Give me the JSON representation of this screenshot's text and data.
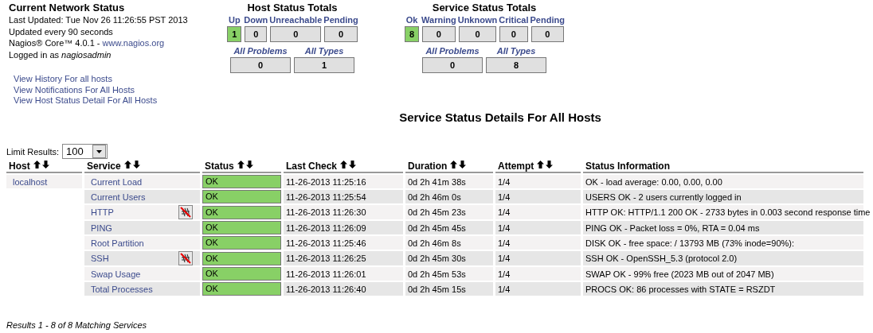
{
  "network_status": {
    "title": "Current Network Status",
    "last_updated": "Last Updated: Tue Nov 26 11:26:55 PST 2013",
    "interval": "Updated every 90 seconds",
    "version_prefix": "Nagios® Core™ 4.0.1 - ",
    "version_link": "www.nagios.org",
    "logged_in_prefix": "Logged in as ",
    "user": "nagiosadmin"
  },
  "links": [
    "View History For all hosts",
    "View Notifications For All Hosts",
    "View Host Status Detail For All Hosts"
  ],
  "host_totals": {
    "title": "Host Status Totals",
    "counts": [
      {
        "label": "Up",
        "value": "1",
        "highlighted": true
      },
      {
        "label": "Down",
        "value": "0",
        "highlighted": false
      },
      {
        "label": "Unreachable",
        "value": "0",
        "highlighted": false
      },
      {
        "label": "Pending",
        "value": "0",
        "highlighted": false
      }
    ],
    "summary": [
      {
        "label": "All Problems",
        "value": "0"
      },
      {
        "label": "All Types",
        "value": "1"
      }
    ]
  },
  "service_totals": {
    "title": "Service Status Totals",
    "counts": [
      {
        "label": "Ok",
        "value": "8",
        "highlighted": true
      },
      {
        "label": "Warning",
        "value": "0",
        "highlighted": false
      },
      {
        "label": "Unknown",
        "value": "0",
        "highlighted": false
      },
      {
        "label": "Critical",
        "value": "0",
        "highlighted": false
      },
      {
        "label": "Pending",
        "value": "0",
        "highlighted": false
      }
    ],
    "summary": [
      {
        "label": "All Problems",
        "value": "0"
      },
      {
        "label": "All Types",
        "value": "8"
      }
    ]
  },
  "page_title": "Service Status Details For All Hosts",
  "limit": {
    "label": "Limit Results:",
    "value": "100"
  },
  "table": {
    "columns": [
      {
        "label": "Host",
        "sortable": true
      },
      {
        "label": "Service",
        "sortable": true
      },
      {
        "label": "Status",
        "sortable": true
      },
      {
        "label": "Last Check",
        "sortable": true
      },
      {
        "label": "Duration",
        "sortable": true
      },
      {
        "label": "Attempt",
        "sortable": true
      },
      {
        "label": "Status Information",
        "sortable": false
      }
    ],
    "rows": [
      {
        "host": "localhost",
        "service": "Current Load",
        "notifications_disabled": false,
        "status": "OK",
        "last_check": "11-26-2013 11:25:16",
        "duration": "0d 2h 41m 38s",
        "attempt": "1/4",
        "info": "OK - load average: 0.00, 0.00, 0.00"
      },
      {
        "service": "Current Users",
        "notifications_disabled": false,
        "status": "OK",
        "last_check": "11-26-2013 11:25:54",
        "duration": "0d 2h 46m 0s",
        "attempt": "1/4",
        "info": "USERS OK - 2 users currently logged in"
      },
      {
        "service": "HTTP",
        "notifications_disabled": true,
        "status": "OK",
        "last_check": "11-26-2013 11:26:30",
        "duration": "0d 2h 45m 23s",
        "attempt": "1/4",
        "info": "HTTP OK: HTTP/1.1 200 OK - 2733 bytes in 0.003 second response time"
      },
      {
        "service": "PING",
        "notifications_disabled": false,
        "status": "OK",
        "last_check": "11-26-2013 11:26:09",
        "duration": "0d 2h 45m 45s",
        "attempt": "1/4",
        "info": "PING OK - Packet loss = 0%, RTA = 0.04 ms"
      },
      {
        "service": "Root Partition",
        "notifications_disabled": false,
        "status": "OK",
        "last_check": "11-26-2013 11:25:46",
        "duration": "0d 2h 46m 8s",
        "attempt": "1/4",
        "info": "DISK OK - free space: / 13793 MB (73% inode=90%):"
      },
      {
        "service": "SSH",
        "notifications_disabled": true,
        "status": "OK",
        "last_check": "11-26-2013 11:26:25",
        "duration": "0d 2h 45m 30s",
        "attempt": "1/4",
        "info": "SSH OK - OpenSSH_5.3 (protocol 2.0)"
      },
      {
        "service": "Swap Usage",
        "notifications_disabled": false,
        "status": "OK",
        "last_check": "11-26-2013 11:26:01",
        "duration": "0d 2h 45m 53s",
        "attempt": "1/4",
        "info": "SWAP OK - 99% free (2023 MB out of 2047 MB)"
      },
      {
        "service": "Total Processes",
        "notifications_disabled": false,
        "status": "OK",
        "last_check": "11-26-2013 11:26:40",
        "duration": "0d 2h 45m 15s",
        "attempt": "1/4",
        "info": "PROCS OK: 86 processes with STATE = RSZDT"
      }
    ]
  },
  "footer": "Results 1 - 8 of 8 Matching Services"
}
